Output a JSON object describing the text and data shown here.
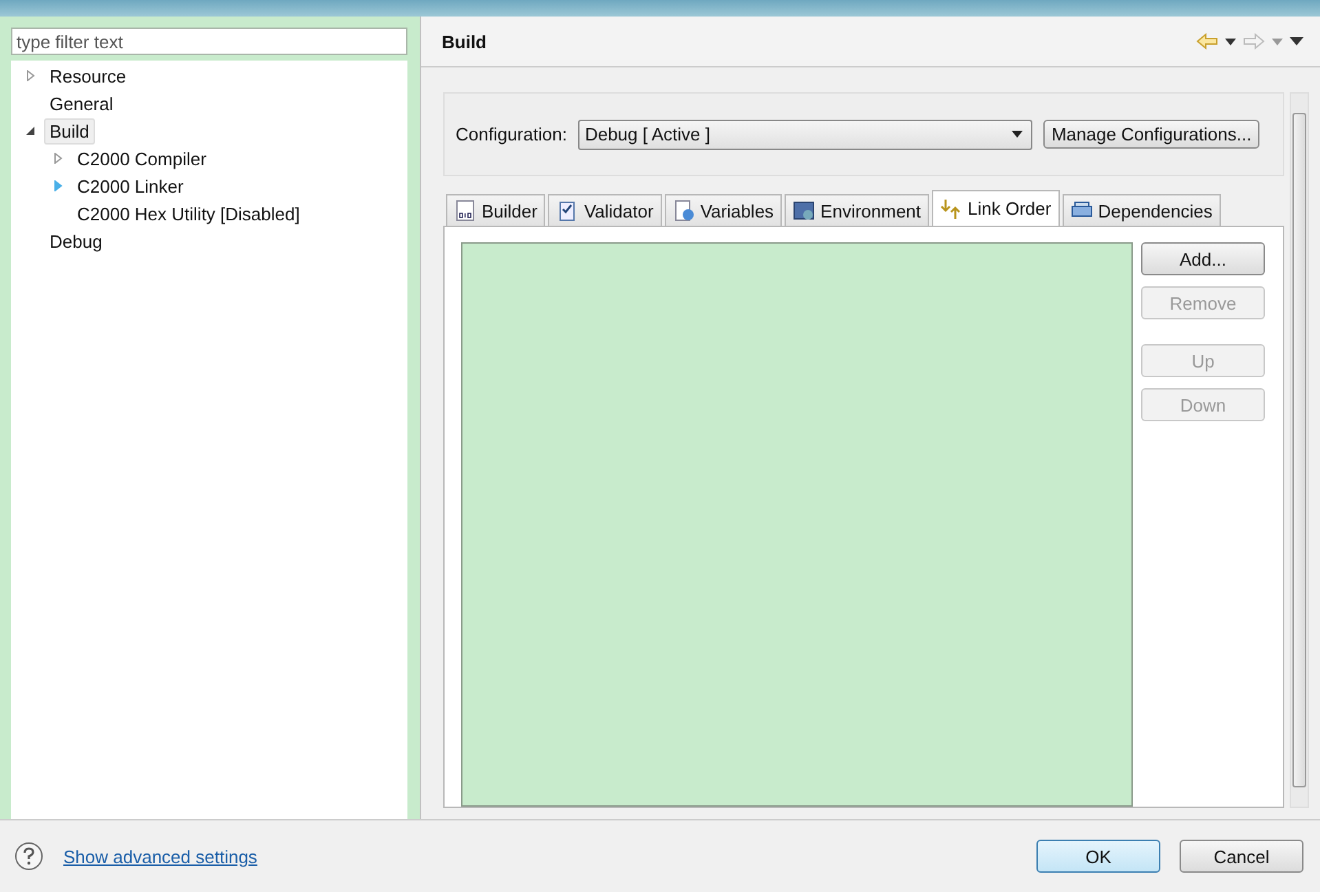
{
  "filter": {
    "placeholder": "type filter text"
  },
  "tree": [
    {
      "label": "Resource",
      "expanded": false,
      "selected": false
    },
    {
      "label": "General",
      "selected": false
    },
    {
      "label": "Build",
      "expanded": true,
      "selected": true,
      "children": [
        {
          "label": "C2000 Compiler",
          "expanded": false,
          "hot": false,
          "selected": false
        },
        {
          "label": "C2000 Linker",
          "expanded": false,
          "hot": true,
          "selected": false
        },
        {
          "label": "C2000 Hex Utility  [Disabled]",
          "selected": false
        }
      ]
    },
    {
      "label": "Debug",
      "selected": false
    }
  ],
  "page_title": "Build",
  "configuration": {
    "label": "Configuration:",
    "value": "Debug  [ Active ]",
    "manage_button": "Manage Configurations..."
  },
  "tabs": [
    {
      "label": "Builder",
      "selected": false
    },
    {
      "label": "Validator",
      "selected": false
    },
    {
      "label": "Variables",
      "selected": false
    },
    {
      "label": "Environment",
      "selected": false
    },
    {
      "label": "Link Order",
      "selected": true
    },
    {
      "label": "Dependencies",
      "selected": false
    }
  ],
  "side_buttons": [
    {
      "label": "Add...",
      "disabled": false
    },
    {
      "label": "Remove",
      "disabled": true
    },
    {
      "label": "Up",
      "disabled": true
    },
    {
      "label": "Down",
      "disabled": true
    }
  ],
  "footer": {
    "link": "Show advanced settings",
    "buttons": [
      {
        "label": "OK",
        "default": true
      },
      {
        "label": "Cancel",
        "default": false
      }
    ]
  }
}
